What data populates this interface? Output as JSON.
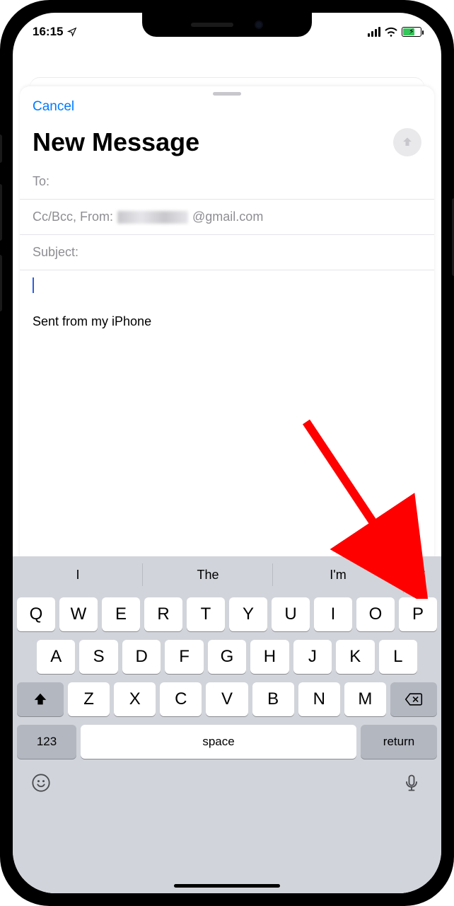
{
  "status": {
    "time": "16:15"
  },
  "sheet": {
    "cancel": "Cancel",
    "title": "New Message",
    "to_label": "To:",
    "ccbcc_label": "Cc/Bcc, From:",
    "from_domain": "@gmail.com",
    "subject_label": "Subject:",
    "signature": "Sent from my iPhone"
  },
  "keyboard": {
    "suggestions": [
      "I",
      "The",
      "I'm"
    ],
    "row1": [
      "Q",
      "W",
      "E",
      "R",
      "T",
      "Y",
      "U",
      "I",
      "O",
      "P"
    ],
    "row2": [
      "A",
      "S",
      "D",
      "F",
      "G",
      "H",
      "J",
      "K",
      "L"
    ],
    "row3": [
      "Z",
      "X",
      "C",
      "V",
      "B",
      "N",
      "M"
    ],
    "num": "123",
    "space": "space",
    "return": "return"
  }
}
